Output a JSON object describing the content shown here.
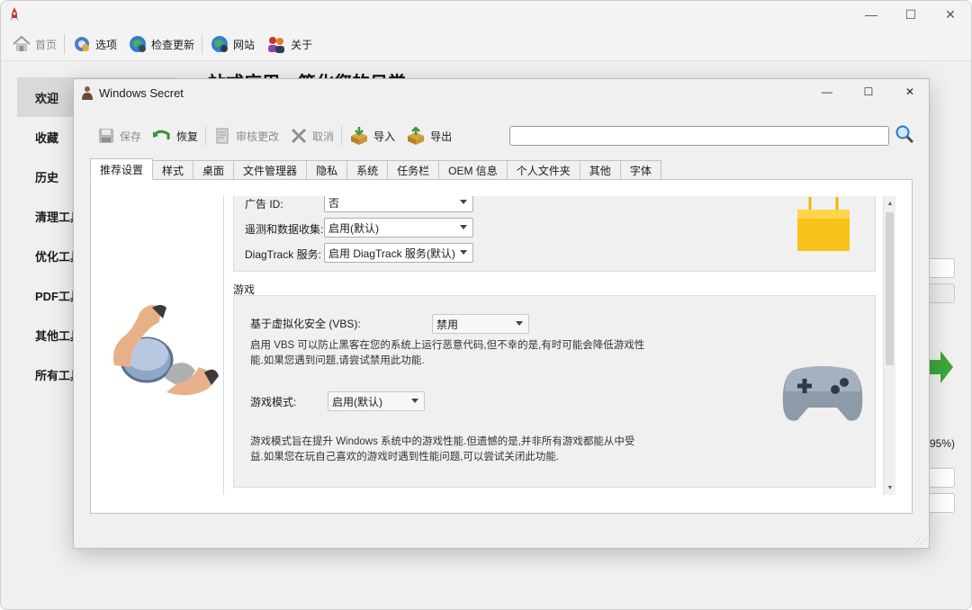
{
  "main_window": {
    "controls": {
      "minimize": "—",
      "maximize": "☐",
      "close": "✕"
    },
    "toolbar": {
      "home_label": "首页",
      "options_label": "选项",
      "update_label": "检查更新",
      "website_label": "网站",
      "about_label": "关于"
    },
    "hero_title": "一站式应用，简化您的日常",
    "sidebar": {
      "items": [
        {
          "label": "欢迎"
        },
        {
          "label": "收藏"
        },
        {
          "label": "历史"
        },
        {
          "label": "清理工具"
        },
        {
          "label": "优化工具"
        },
        {
          "label": "PDF工具"
        },
        {
          "label": "其他工具"
        },
        {
          "label": "所有工具"
        }
      ]
    },
    "progress_text": "95%)"
  },
  "dialog": {
    "title": "Windows Secret",
    "controls": {
      "minimize": "—",
      "maximize": "☐",
      "close": "✕"
    },
    "toolbar": {
      "save_label": "保存",
      "restore_label": "恢复",
      "review_label": "审核更改",
      "cancel_label": "取消",
      "import_label": "导入",
      "export_label": "导出"
    },
    "search": {
      "value": "",
      "placeholder": ""
    },
    "tabs": [
      {
        "label": "推荐设置"
      },
      {
        "label": "样式"
      },
      {
        "label": "桌面"
      },
      {
        "label": "文件管理器"
      },
      {
        "label": "隐私"
      },
      {
        "label": "系统"
      },
      {
        "label": "任务栏"
      },
      {
        "label": "OEM 信息"
      },
      {
        "label": "个人文件夹"
      },
      {
        "label": "其他"
      },
      {
        "label": "字体"
      }
    ],
    "privacy": {
      "ad_id_label": "广告 ID:",
      "ad_id_value": "否",
      "telemetry_label": "遥测和数据收集:",
      "telemetry_value": "启用(默认)",
      "diagtrack_label": "DiagTrack 服务:",
      "diagtrack_value": "启用 DiagTrack 服务(默认)"
    },
    "gaming": {
      "section_title": "游戏",
      "vbs_label": "基于虚拟化安全 (VBS):",
      "vbs_value": "禁用",
      "vbs_desc": "启用 VBS 可以防止黑客在您的系统上运行恶意代码,但不幸的是,有时可能会降低游戏性能.如果您遇到问题,请尝试禁用此功能.",
      "game_mode_label": "游戏模式:",
      "game_mode_value": "启用(默认)",
      "game_mode_desc": "游戏模式旨在提升 Windows 系统中的游戏性能.但遗憾的是,并非所有游戏都能从中受益.如果您在玩自己喜欢的游戏时遇到性能问题,可以尝试关闭此功能."
    },
    "colors": {
      "accent_green": "#3ca63c",
      "yellow_icon": "#f7c31a"
    }
  }
}
